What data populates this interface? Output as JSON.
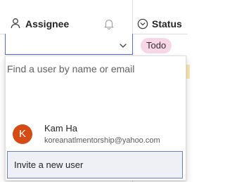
{
  "columns": {
    "assignee": {
      "label": "Assignee",
      "icon": "person-icon",
      "secondary_icon": "bell-icon"
    },
    "status": {
      "label": "Status",
      "icon": "status-circle-chevron-icon"
    }
  },
  "row": {
    "assignee_value": "",
    "status": {
      "label": "Todo",
      "color": "#f7d6e6"
    }
  },
  "assignee_dropdown": {
    "search_placeholder": "Find a user by name or email",
    "users": [
      {
        "initial": "K",
        "name": "Kam Ha",
        "email": "koreanatlmentorship@yahoo.com",
        "avatar_color": "#d64a14"
      }
    ],
    "invite_label": "Invite a new user"
  },
  "colors": {
    "accent": "#4f6bed",
    "border": "#e1dfdd",
    "invite_highlight": "#eef0f6"
  }
}
